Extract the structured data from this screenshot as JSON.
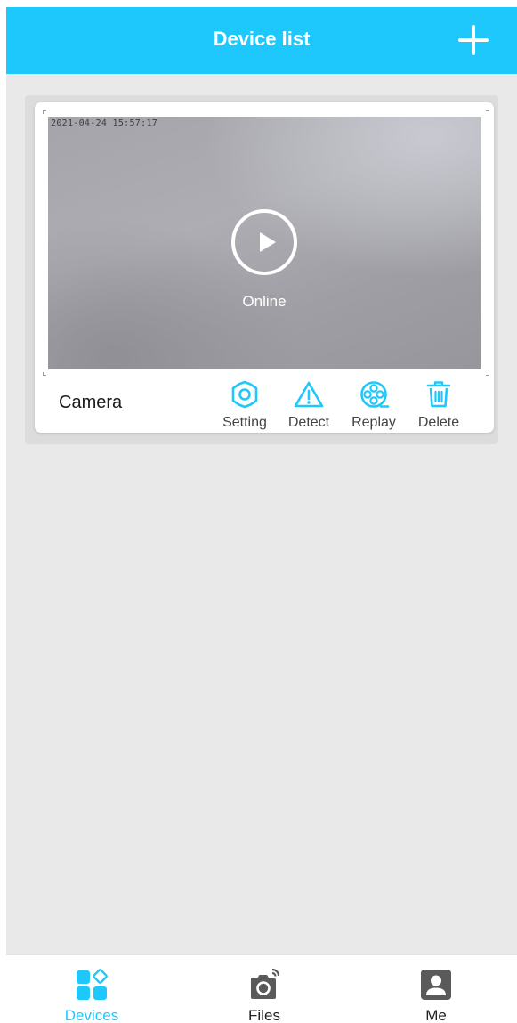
{
  "header": {
    "title": "Device list",
    "add_icon": "plus-icon"
  },
  "device_card": {
    "name": "Camera",
    "timestamp": "2021-04-24 15:57:17",
    "status": "Online",
    "play_icon": "play-circle-icon",
    "actions": [
      {
        "label": "Setting",
        "icon": "gear-icon"
      },
      {
        "label": "Detect",
        "icon": "warning-triangle-icon"
      },
      {
        "label": "Replay",
        "icon": "film-reel-icon"
      },
      {
        "label": "Delete",
        "icon": "trash-icon"
      }
    ]
  },
  "bottom_nav": {
    "items": [
      {
        "label": "Devices",
        "icon": "devices-grid-icon",
        "active": true
      },
      {
        "label": "Files",
        "icon": "camera-icon",
        "active": false
      },
      {
        "label": "Me",
        "icon": "person-icon",
        "active": false
      }
    ]
  },
  "colors": {
    "accent": "#1ec8fc",
    "background": "#e9e9e9",
    "nav_inactive": "#5a5a5a",
    "text_primary": "#1a1a1a"
  }
}
